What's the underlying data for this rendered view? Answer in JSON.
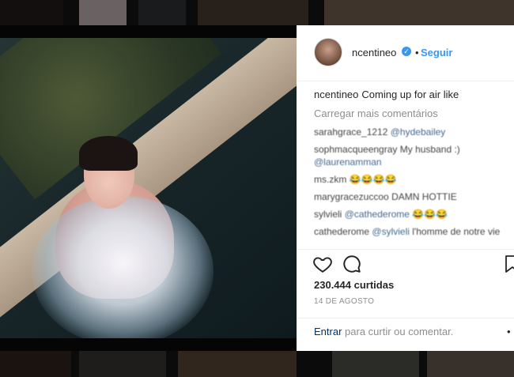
{
  "post": {
    "username": "ncentineo",
    "separator": "•",
    "follow_label": "Seguir",
    "verified_mark": "✓",
    "caption_user": "ncentineo",
    "caption_text": "Coming up for air like",
    "load_more_label": "Carregar mais comentários",
    "comments": [
      {
        "user": "sarahgrace_1212",
        "text": "",
        "mention": "@hydebailey"
      },
      {
        "user": "sophmacqueengray",
        "text": "My husband :)",
        "mention": "@laurenamman"
      },
      {
        "user": "ms.zkm",
        "text": "😂😂😂😂",
        "mention": ""
      },
      {
        "user": "marygracezuccoo",
        "text": "DAMN HOTTIE",
        "mention": ""
      },
      {
        "user": "sylvieli",
        "text": "😂😂😂",
        "mention": "@cathederome"
      },
      {
        "user": "cathederome",
        "text": "l'homme de notre vie",
        "mention": "@sylvieli"
      }
    ],
    "likes": "230.444 curtidas",
    "date": "14 DE AGOSTO",
    "login_link": "Entrar",
    "login_rest": "para curtir ou comentar.",
    "more_label": "•"
  },
  "colors": {
    "link": "#3897f0",
    "text": "#262626",
    "muted": "#8e8e8e"
  },
  "icons": [
    "verified-badge-icon",
    "heart-icon",
    "comment-icon",
    "bookmark-icon"
  ]
}
